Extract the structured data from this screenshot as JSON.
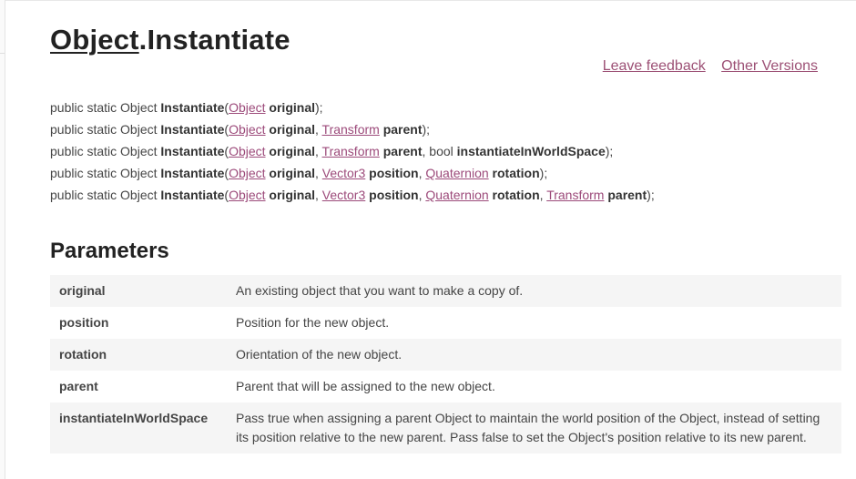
{
  "title": {
    "link": "Object",
    "rest": ".Instantiate"
  },
  "links": {
    "feedback": "Leave feedback",
    "versions": "Other Versions"
  },
  "sig_prefix": "public static Object ",
  "method": "Instantiate",
  "signatures": [
    [
      {
        "t": "link",
        "v": "Object"
      },
      {
        "t": "bold",
        "v": " original"
      }
    ],
    [
      {
        "t": "link",
        "v": "Object"
      },
      {
        "t": "bold",
        "v": " original"
      },
      {
        "t": "text",
        "v": ", "
      },
      {
        "t": "link",
        "v": "Transform"
      },
      {
        "t": "bold",
        "v": " parent"
      }
    ],
    [
      {
        "t": "link",
        "v": "Object"
      },
      {
        "t": "bold",
        "v": " original"
      },
      {
        "t": "text",
        "v": ", "
      },
      {
        "t": "link",
        "v": "Transform"
      },
      {
        "t": "bold",
        "v": " parent"
      },
      {
        "t": "text",
        "v": ", bool "
      },
      {
        "t": "bold",
        "v": "instantiateInWorldSpace"
      }
    ],
    [
      {
        "t": "link",
        "v": "Object"
      },
      {
        "t": "bold",
        "v": " original"
      },
      {
        "t": "text",
        "v": ", "
      },
      {
        "t": "link",
        "v": "Vector3"
      },
      {
        "t": "bold",
        "v": " position"
      },
      {
        "t": "text",
        "v": ", "
      },
      {
        "t": "link",
        "v": "Quaternion"
      },
      {
        "t": "bold",
        "v": " rotation"
      }
    ],
    [
      {
        "t": "link",
        "v": "Object"
      },
      {
        "t": "bold",
        "v": " original"
      },
      {
        "t": "text",
        "v": ", "
      },
      {
        "t": "link",
        "v": "Vector3"
      },
      {
        "t": "bold",
        "v": " position"
      },
      {
        "t": "text",
        "v": ", "
      },
      {
        "t": "link",
        "v": "Quaternion"
      },
      {
        "t": "bold",
        "v": " rotation"
      },
      {
        "t": "text",
        "v": ", "
      },
      {
        "t": "link",
        "v": "Transform"
      },
      {
        "t": "bold",
        "v": " parent"
      }
    ]
  ],
  "parameters_heading": "Parameters",
  "parameters": [
    {
      "name": "original",
      "desc": "An existing object that you want to make a copy of."
    },
    {
      "name": "position",
      "desc": "Position for the new object."
    },
    {
      "name": "rotation",
      "desc": "Orientation of the new object."
    },
    {
      "name": "parent",
      "desc": "Parent that will be assigned to the new object."
    },
    {
      "name": "instantiateInWorldSpace",
      "desc": "Pass true when assigning a parent Object to maintain the world position of the Object, instead of setting its position relative to the new parent. Pass false to set the Object's position relative to its new parent."
    }
  ],
  "colors": {
    "link": "#9c4a7a",
    "heading": "#222222",
    "row_alt": "#f5f5f5"
  }
}
